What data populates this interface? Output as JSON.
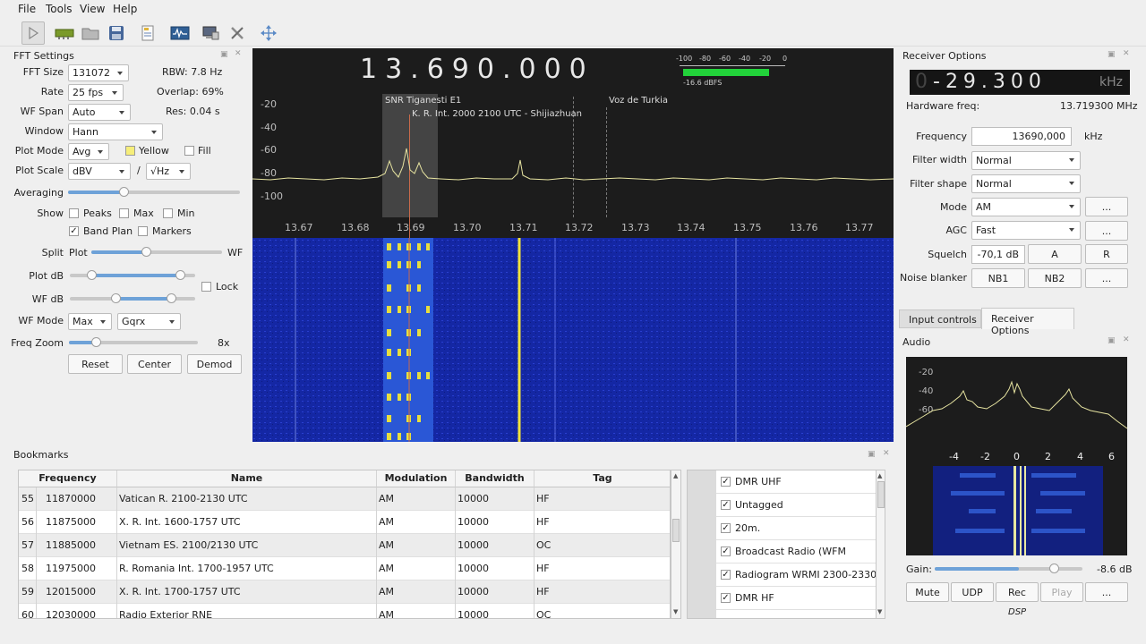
{
  "menu": {
    "file": "File",
    "tools": "Tools",
    "view": "View",
    "help": "Help"
  },
  "fft": {
    "title": "FFT Settings",
    "fft_size_label": "FFT Size",
    "fft_size": "131072",
    "rbw": "RBW: 7.8 Hz",
    "rate_label": "Rate",
    "rate": "25 fps",
    "overlap": "Overlap: 69%",
    "wf_span_label": "WF Span",
    "wf_span": "Auto",
    "res": "Res: 0.04 s",
    "window_label": "Window",
    "window": "Hann",
    "plot_mode_label": "Plot Mode",
    "plot_mode": "Avg",
    "yellow": "Yellow",
    "fill": "Fill",
    "plot_scale_label": "Plot Scale",
    "plot_scale": "dBV",
    "slash": "/",
    "plot_scale2": "√Hz",
    "averaging_label": "Averaging",
    "averaging_level": 0.3,
    "show_label": "Show",
    "peaks": "Peaks",
    "max": "Max",
    "min": "Min",
    "band_plan": "Band Plan",
    "markers": "Markers",
    "split_label": "Split",
    "split_plot": "Plot",
    "split_wf": "WF",
    "split_level": 0.4,
    "plot_db_label": "Plot dB",
    "wf_db_label": "WF dB",
    "lock": "Lock",
    "wf_mode_label": "WF Mode",
    "wf_mode": "Max",
    "wf_palette": "Gqrx",
    "freq_zoom_label": "Freq Zoom",
    "freq_zoom_value": "8x",
    "freq_zoom_level": 0.2,
    "reset": "Reset",
    "center": "Center",
    "demod": "Demod"
  },
  "plot": {
    "frequency_display": "13.690.000",
    "meter_ticks": [
      "-100",
      "-80",
      "-60",
      "-40",
      "-20",
      "0"
    ],
    "meter_value": "-16.6 dBFS",
    "y_ticks": [
      "-20",
      "-40",
      "-60",
      "-80",
      "-100"
    ],
    "x_ticks": [
      "13.67",
      "13.68",
      "13.69",
      "13.70",
      "13.71",
      "13.72",
      "13.73",
      "13.74",
      "13.75",
      "13.76",
      "13.77"
    ],
    "band_labels": [
      "SNR Tiganesti E1",
      "K. R. Int. 2000 2100 UTC - Shijiazhuan",
      "Voz de Turkia"
    ]
  },
  "receiver": {
    "title": "Receiver Options",
    "offset_prefix": "0",
    "offset": "-29.300",
    "offset_unit": "kHz",
    "hw_label": "Hardware freq:",
    "hw_value": "13.719300 MHz",
    "freq_label": "Frequency",
    "freq_value": "13690,000",
    "freq_unit": "kHz",
    "filter_width_label": "Filter width",
    "filter_width": "Normal",
    "filter_shape_label": "Filter shape",
    "filter_shape": "Normal",
    "mode_label": "Mode",
    "mode": "AM",
    "agc_label": "AGC",
    "agc": "Fast",
    "more": "...",
    "squelch_label": "Squelch",
    "squelch_value": "-70,1 dB",
    "a": "A",
    "r": "R",
    "nb_label": "Noise blanker",
    "nb1": "NB1",
    "nb2": "NB2",
    "tab_input": "Input controls",
    "tab_receiver": "Receiver Options"
  },
  "audio": {
    "title": "Audio",
    "y_ticks": [
      "-20",
      "-40",
      "-60"
    ],
    "x_ticks": [
      "-4",
      "-2",
      "0",
      "2",
      "4",
      "6"
    ],
    "gain_label": "Gain:",
    "gain_value": "-8.6 dB",
    "gain_level": 0.75,
    "mute": "Mute",
    "udp": "UDP",
    "rec": "Rec",
    "play": "Play",
    "more": "...",
    "dsp": "DSP"
  },
  "bookmarks": {
    "title": "Bookmarks",
    "columns": [
      "Frequency",
      "Name",
      "Modulation",
      "Bandwidth",
      "Tag"
    ],
    "rows": [
      {
        "idx": "55",
        "freq": "11870000",
        "name": "Vatican R. 2100-2130 UTC",
        "mod": "AM",
        "bw": "10000",
        "tag": "HF"
      },
      {
        "idx": "56",
        "freq": "11875000",
        "name": "X. R. Int. 1600-1757 UTC",
        "mod": "AM",
        "bw": "10000",
        "tag": "HF"
      },
      {
        "idx": "57",
        "freq": "11885000",
        "name": "Vietnam ES. 2100/2130 UTC",
        "mod": "AM",
        "bw": "10000",
        "tag": "OC"
      },
      {
        "idx": "58",
        "freq": "11975000",
        "name": "R. Romania Int. 1700-1957 UTC",
        "mod": "AM",
        "bw": "10000",
        "tag": "HF"
      },
      {
        "idx": "59",
        "freq": "12015000",
        "name": "X. R. Int. 1700-1757 UTC",
        "mod": "AM",
        "bw": "10000",
        "tag": "HF"
      },
      {
        "idx": "60",
        "freq": "12030000",
        "name": "Radio Exterior RNE",
        "mod": "AM",
        "bw": "10000",
        "tag": "OC"
      }
    ],
    "tags": [
      "DMR UHF",
      "Untagged",
      "20m.",
      "Broadcast Radio (WFM",
      "Radiogram WRMI 2300-2330 ...",
      "DMR HF"
    ]
  },
  "colors": {
    "spectrum_trace": "#e6e3a0",
    "waterfall_bg": "#1427a4",
    "signal": "#f2e24a",
    "accent": "#6ea2d8"
  }
}
